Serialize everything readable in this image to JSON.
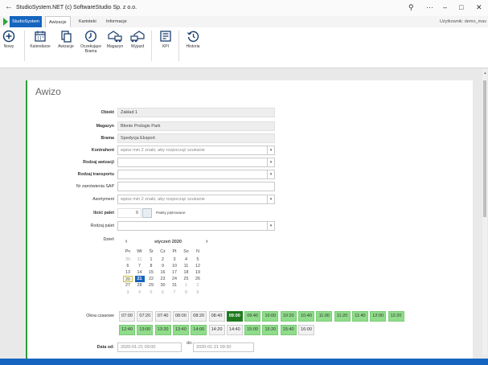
{
  "window": {
    "title": "StudioSystem.NET (c) SoftwareStudio Sp. z o.o.",
    "back": "←",
    "search": "⚲",
    "more": "···",
    "minimize": "–",
    "maximize": "□",
    "close": "✕"
  },
  "tabs": [
    {
      "label": "StudioSystem"
    },
    {
      "label": "Awizacje"
    },
    {
      "label": "Kartoteki"
    },
    {
      "label": "Informacje"
    }
  ],
  "user": "Użytkownik: demo_mav",
  "ribbon": [
    {
      "label": "Nowy",
      "icon": "plus-icon"
    },
    {
      "label": "Kalendarze",
      "icon": "calendar-icon"
    },
    {
      "label": "Awizacje",
      "icon": "copy-icon"
    },
    {
      "label": "Oczekujące Brama",
      "icon": "clock-icon"
    },
    {
      "label": "Magazyn",
      "icon": "warehouse-truck-icon"
    },
    {
      "label": "Wyjazd",
      "icon": "truck-exit-icon"
    },
    {
      "label": "KPI",
      "icon": "kpi-icon"
    },
    {
      "label": "Historia",
      "icon": "history-icon"
    }
  ],
  "form": {
    "title": "Awizo",
    "obiekt": {
      "label": "Obiekt",
      "value": "Zakład 1"
    },
    "magazyn": {
      "label": "Magazyn",
      "value": "Błonie Prologis Park"
    },
    "brama": {
      "label": "Brama",
      "value": "Spedycja Eksport"
    },
    "kontrahent": {
      "label": "Kontrahent",
      "placeholder": "wpisz min 2 znaki, aby rozpocząć szukanie"
    },
    "rodzaj_awizacji": {
      "label": "Rodzaj awizacji",
      "value": ""
    },
    "rodzaj_transportu": {
      "label": "Rodzaj transportu",
      "value": ""
    },
    "nr_zamowienia": {
      "label": "Nr zamówienia SAP",
      "value": ""
    },
    "asortyment": {
      "label": "Asortyment",
      "placeholder": "wpisz min 2 znaki, aby rozpocząć szukanie"
    },
    "ilosc_palet": {
      "label": "Ilość palet",
      "value": "0",
      "checkbox_label": "Palety piętrowane",
      "checked": false
    },
    "rodzaj_palet": {
      "label": "Rodzaj palet",
      "value": ""
    },
    "dzien": {
      "label": "Dzień"
    },
    "okna": {
      "label": "Okna czasowe"
    },
    "data_od": {
      "label": "Data od:",
      "value": "2020-01-21 09:00"
    },
    "data_do": {
      "label": "do:",
      "value": "2020-01-21 09:30"
    }
  },
  "calendar": {
    "month": "styczeń 2020",
    "prev": "‹",
    "next": "›",
    "dow": [
      "Pn",
      "Wt",
      "Śr",
      "Cz",
      "Pt",
      "So",
      "N"
    ],
    "weeks": [
      [
        "30",
        "31",
        "1",
        "2",
        "3",
        "4",
        "5"
      ],
      [
        "6",
        "7",
        "8",
        "9",
        "10",
        "11",
        "12"
      ],
      [
        "13",
        "14",
        "15",
        "16",
        "17",
        "18",
        "19"
      ],
      [
        "20",
        "21",
        "22",
        "23",
        "24",
        "25",
        "26"
      ],
      [
        "27",
        "28",
        "29",
        "30",
        "31",
        "1",
        "2"
      ],
      [
        "3",
        "4",
        "5",
        "6",
        "7",
        "8",
        "9"
      ]
    ],
    "today": "20",
    "selected": "21"
  },
  "slots": [
    {
      "time": "07:00",
      "state": "grey"
    },
    {
      "time": "07:20",
      "state": "grey"
    },
    {
      "time": "07:40",
      "state": "grey"
    },
    {
      "time": "08:00",
      "state": "grey"
    },
    {
      "time": "08:20",
      "state": "grey"
    },
    {
      "time": "08:40",
      "state": "grey"
    },
    {
      "time": "09:00",
      "state": "selected"
    },
    {
      "time": "09:40",
      "state": "green"
    },
    {
      "time": "10:00",
      "state": "green"
    },
    {
      "time": "10:20",
      "state": "green"
    },
    {
      "time": "10:40",
      "state": "green"
    },
    {
      "time": "11:00",
      "state": "green"
    },
    {
      "time": "11:20",
      "state": "green"
    },
    {
      "time": "11:40",
      "state": "green"
    },
    {
      "time": "12:00",
      "state": "green"
    },
    {
      "time": "12:20",
      "state": "green"
    },
    {
      "time": "12:40",
      "state": "green"
    },
    {
      "time": "13:00",
      "state": "green"
    },
    {
      "time": "13:20",
      "state": "green"
    },
    {
      "time": "13:40",
      "state": "green"
    },
    {
      "time": "14:00",
      "state": "green"
    },
    {
      "time": "14:20",
      "state": "grey"
    },
    {
      "time": "14:40",
      "state": "grey"
    },
    {
      "time": "15:00",
      "state": "green"
    },
    {
      "time": "15:20",
      "state": "green"
    },
    {
      "time": "15:40",
      "state": "green"
    },
    {
      "time": "16:00",
      "state": "grey"
    }
  ],
  "colors": {
    "brand": "#1565c0",
    "accent": "#2e9c3a",
    "slot_green": "#8fdc8a",
    "slot_selected": "#1f7a1f"
  }
}
